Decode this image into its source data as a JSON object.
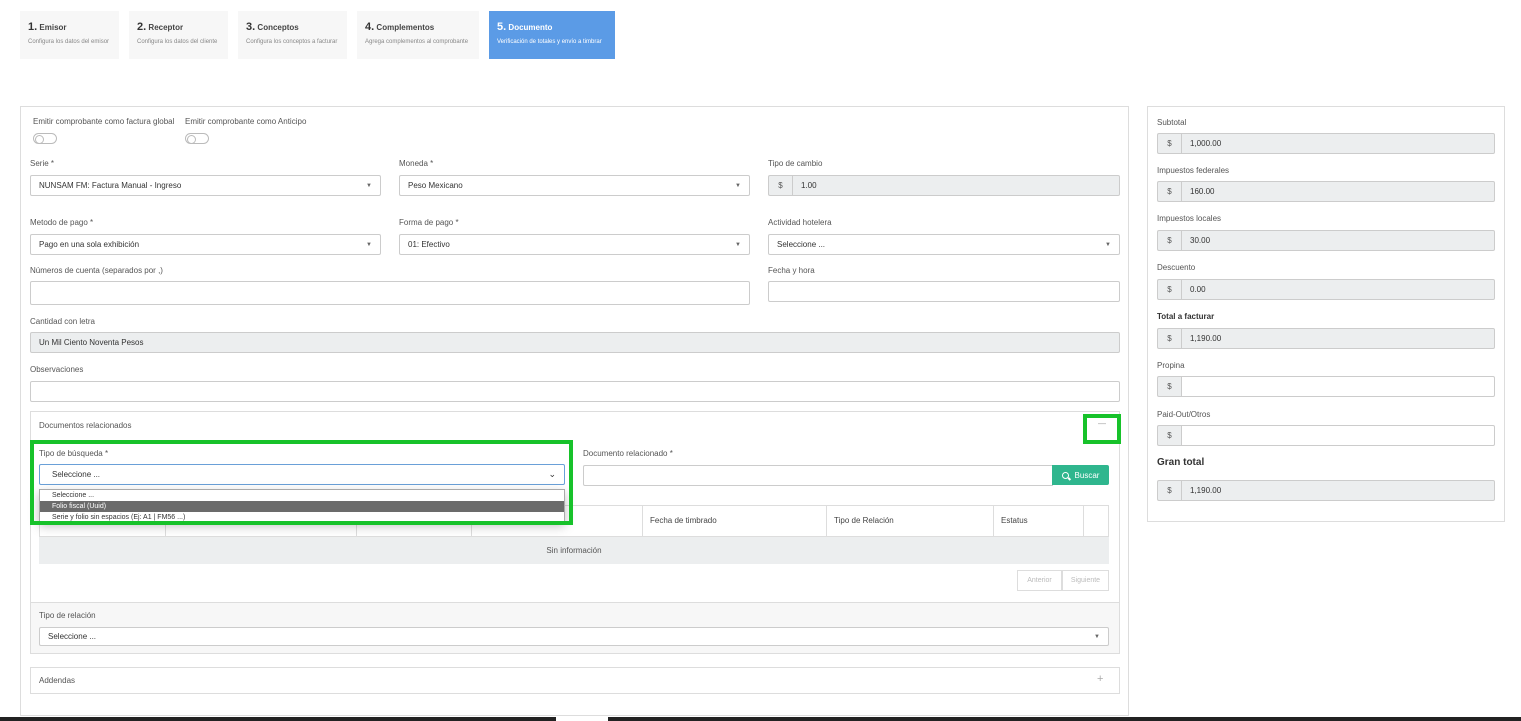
{
  "steps": [
    {
      "num": "1.",
      "title": "Emisor",
      "sub": "Configura los datos del emisor"
    },
    {
      "num": "2.",
      "title": "Receptor",
      "sub": "Configura los datos del cliente"
    },
    {
      "num": "3.",
      "title": "Conceptos",
      "sub": "Configura los conceptos a facturar"
    },
    {
      "num": "4.",
      "title": "Complementos",
      "sub": "Agrega complementos al comprobante"
    },
    {
      "num": "5.",
      "title": "Documento",
      "sub": "Verificación de totales y envío a timbrar"
    }
  ],
  "form": {
    "global_label": "Emitir comprobante como factura global",
    "anticipo_label": "Emitir comprobante como Anticipo",
    "serie_label": "Serie *",
    "serie_value": "NUNSAM FM: Factura Manual - Ingreso",
    "moneda_label": "Moneda *",
    "moneda_value": "Peso Mexicano",
    "tipo_cambio_label": "Tipo de cambio",
    "tipo_cambio_value": "1.00",
    "metodo_label": "Metodo de pago *",
    "metodo_value": "Pago en una sola exhibición",
    "forma_label": "Forma de pago *",
    "forma_value": "01: Efectivo",
    "actividad_label": "Actividad hotelera",
    "actividad_value": "Seleccione ...",
    "cuentas_label": "Números de cuenta (separados por ,)",
    "fecha_label": "Fecha y hora",
    "cantidad_label": "Cantidad con letra",
    "cantidad_value": "Un Mil Ciento Noventa Pesos",
    "observaciones_label": "Observaciones"
  },
  "related": {
    "title": "Documentos relacionados",
    "collapse_symbol": "—",
    "tipo_busqueda_label": "Tipo de búsqueda *",
    "tipo_busqueda_value": "Seleccione ...",
    "options": [
      "Seleccione ...",
      "Folio fiscal (Uuid)",
      "Serie y folio sin espacios (Ej: A1 | FM56 ...)"
    ],
    "doc_label": "Documento relacionado *",
    "search_button": "Buscar",
    "columns": [
      "Fecha de timbrado",
      "Tipo de Relación",
      "Estatus"
    ],
    "empty": "Sin información",
    "prev": "Anterior",
    "next": "Siguiente",
    "tipo_relacion_label": "Tipo de relación",
    "tipo_relacion_value": "Seleccione ..."
  },
  "addendas": {
    "title": "Addendas",
    "expand_symbol": "+"
  },
  "totals": {
    "currency": "$",
    "subtotal_label": "Subtotal",
    "subtotal": "1,000.00",
    "fed_label": "Impuestos federales",
    "fed": "160.00",
    "loc_label": "Impuestos locales",
    "loc": "30.00",
    "desc_label": "Descuento",
    "desc": "0.00",
    "total_label": "Total a facturar",
    "total": "1,190.00",
    "propina_label": "Propina",
    "paid_label": "Paid-Out/Otros",
    "gran_label": "Gran total",
    "gran": "1,190.00"
  }
}
